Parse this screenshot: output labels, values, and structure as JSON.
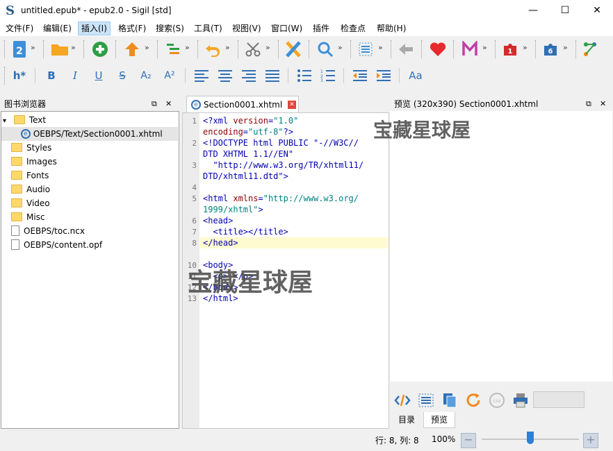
{
  "window": {
    "title": "untitled.epub* - epub2.0 - Sigil [std]",
    "minimize": "—",
    "maximize": "☐",
    "close": "✕"
  },
  "menu": [
    "文件(F)",
    "编辑(E)",
    "插入(I)",
    "格式(F)",
    "搜索(S)",
    "工具(T)",
    "视图(V)",
    "窗口(W)",
    "插件",
    "检查点",
    "帮助(H)"
  ],
  "toolbar2": {
    "heading": "h*",
    "bold": "B",
    "italic": "I",
    "underline": "U",
    "strike": "S",
    "subscript": "A₂",
    "superscript": "A²",
    "case": "Aa"
  },
  "book_browser": {
    "title": "图书浏览器",
    "items": [
      {
        "label": "Text"
      },
      {
        "label": "OEBPS/Text/Section0001.xhtml"
      },
      {
        "label": "Styles"
      },
      {
        "label": "Images"
      },
      {
        "label": "Fonts"
      },
      {
        "label": "Audio"
      },
      {
        "label": "Video"
      },
      {
        "label": "Misc"
      },
      {
        "label": "OEBPS/toc.ncx"
      },
      {
        "label": "OEBPS/content.opf"
      }
    ]
  },
  "editor": {
    "tab_label": "Section0001.xhtml",
    "line_numbers": [
      "1",
      "2",
      "3",
      "4",
      "5",
      "6",
      "7",
      "8",
      "9",
      "10",
      "11",
      "12",
      "13"
    ]
  },
  "preview": {
    "title": "预览 (320x390) Section0001.xhtml",
    "tabs": [
      "目录",
      "预览"
    ]
  },
  "status": {
    "position": "行: 8, 列: 8",
    "zoom": "100%",
    "zoom_slider": 0.5
  },
  "watermark": "宝藏星球屋"
}
